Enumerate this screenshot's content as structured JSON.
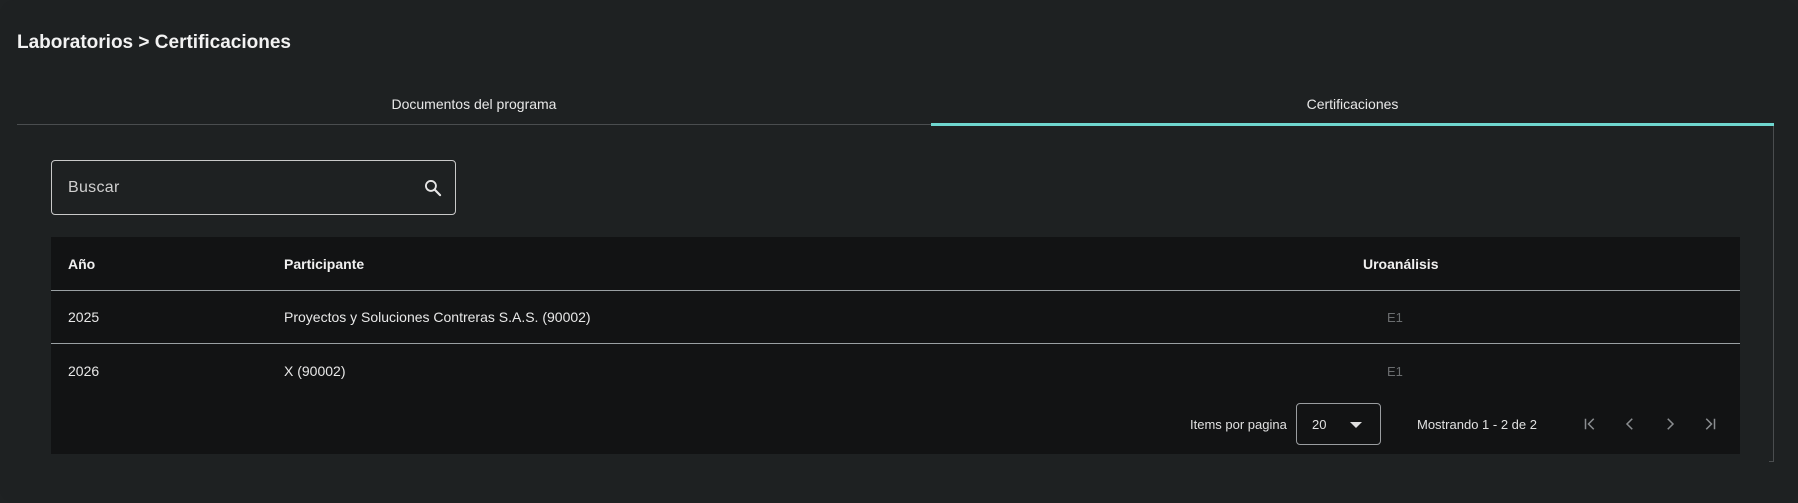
{
  "breadcrumb": "Laboratorios > Certificaciones",
  "tabs": [
    {
      "label": "Documentos del programa",
      "active": false
    },
    {
      "label": "Certificaciones",
      "active": true
    }
  ],
  "search": {
    "placeholder": "Buscar",
    "value": ""
  },
  "table": {
    "headers": {
      "year": "Año",
      "participant": "Participante",
      "uro": "Uroanálisis"
    },
    "rows": [
      {
        "year": "2025",
        "participant": "Proyectos y Soluciones Contreras S.A.S. (90002)",
        "uro": "E1"
      },
      {
        "year": "2026",
        "participant": "X (90002)",
        "uro": "E1"
      }
    ]
  },
  "paginator": {
    "items_label": "Items por pagina",
    "page_size": "20",
    "range": "Mostrando 1 - 2 de 2"
  },
  "colors": {
    "accent": "#6fd6cf",
    "background": "#1e2122",
    "table_bg": "#121314"
  },
  "icons": [
    "search-icon",
    "first-page-icon",
    "previous-page-icon",
    "next-page-icon",
    "last-page-icon",
    "dropdown-caret-icon"
  ]
}
